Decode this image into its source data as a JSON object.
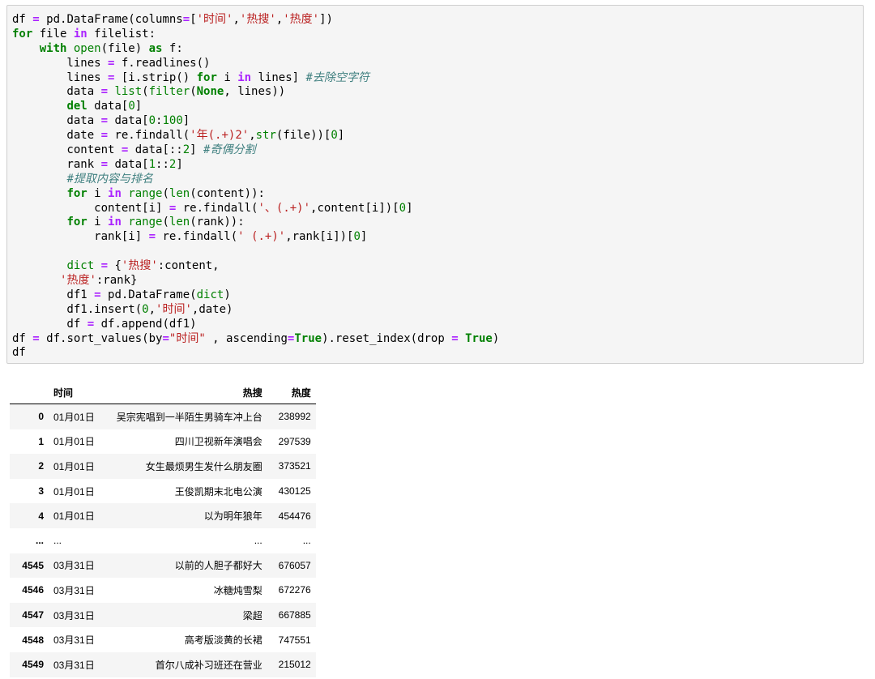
{
  "code_lines": [
    [
      [
        "df ",
        ""
      ],
      [
        "=",
        "op"
      ],
      [
        " pd.DataFrame(columns",
        ""
      ],
      [
        "=",
        "op"
      ],
      [
        "[",
        ""
      ],
      [
        "'时间'",
        "str"
      ],
      [
        ",",
        ""
      ],
      [
        "'热搜'",
        "str"
      ],
      [
        ",",
        ""
      ],
      [
        "'热度'",
        "str"
      ],
      [
        "])",
        ""
      ]
    ],
    [
      [
        "for",
        "kw"
      ],
      [
        " file ",
        ""
      ],
      [
        "in",
        "op"
      ],
      [
        " filelist:",
        ""
      ]
    ],
    [
      [
        "    ",
        ""
      ],
      [
        "with",
        "kw"
      ],
      [
        " ",
        ""
      ],
      [
        "open",
        "bi"
      ],
      [
        "(file) ",
        ""
      ],
      [
        "as",
        "kw"
      ],
      [
        " f:",
        ""
      ]
    ],
    [
      [
        "        lines ",
        ""
      ],
      [
        "=",
        "op"
      ],
      [
        " f.readlines()",
        ""
      ]
    ],
    [
      [
        "        lines ",
        ""
      ],
      [
        "=",
        "op"
      ],
      [
        " [i.strip() ",
        ""
      ],
      [
        "for",
        "kw"
      ],
      [
        " i ",
        ""
      ],
      [
        "in",
        "op"
      ],
      [
        " lines] ",
        ""
      ],
      [
        "#去除空字符",
        "cm"
      ]
    ],
    [
      [
        "        data ",
        ""
      ],
      [
        "=",
        "op"
      ],
      [
        " ",
        ""
      ],
      [
        "list",
        "bi"
      ],
      [
        "(",
        ""
      ],
      [
        "filter",
        "bi"
      ],
      [
        "(",
        ""
      ],
      [
        "None",
        "kw"
      ],
      [
        ", lines))",
        ""
      ]
    ],
    [
      [
        "        ",
        ""
      ],
      [
        "del",
        "kw"
      ],
      [
        " data[",
        ""
      ],
      [
        "0",
        "num"
      ],
      [
        "]",
        ""
      ]
    ],
    [
      [
        "        data ",
        ""
      ],
      [
        "=",
        "op"
      ],
      [
        " data[",
        ""
      ],
      [
        "0",
        "num"
      ],
      [
        ":",
        ""
      ],
      [
        "100",
        "num"
      ],
      [
        "]",
        ""
      ]
    ],
    [
      [
        "        date ",
        ""
      ],
      [
        "=",
        "op"
      ],
      [
        " re.findall(",
        ""
      ],
      [
        "'年(.+)2'",
        "str"
      ],
      [
        ",",
        ""
      ],
      [
        "str",
        "bi"
      ],
      [
        "(file))[",
        ""
      ],
      [
        "0",
        "num"
      ],
      [
        "]",
        ""
      ]
    ],
    [
      [
        "        content ",
        ""
      ],
      [
        "=",
        "op"
      ],
      [
        " data[::",
        ""
      ],
      [
        "2",
        "num"
      ],
      [
        "] ",
        ""
      ],
      [
        "#奇偶分割",
        "cm"
      ]
    ],
    [
      [
        "        rank ",
        ""
      ],
      [
        "=",
        "op"
      ],
      [
        " data[",
        ""
      ],
      [
        "1",
        "num"
      ],
      [
        "::",
        ""
      ],
      [
        "2",
        "num"
      ],
      [
        "]",
        ""
      ]
    ],
    [
      [
        "        ",
        ""
      ],
      [
        "#提取内容与排名",
        "cm"
      ]
    ],
    [
      [
        "        ",
        ""
      ],
      [
        "for",
        "kw"
      ],
      [
        " i ",
        ""
      ],
      [
        "in",
        "op"
      ],
      [
        " ",
        ""
      ],
      [
        "range",
        "bi"
      ],
      [
        "(",
        ""
      ],
      [
        "len",
        "bi"
      ],
      [
        "(content)):",
        ""
      ]
    ],
    [
      [
        "            content[i] ",
        ""
      ],
      [
        "=",
        "op"
      ],
      [
        " re.findall(",
        ""
      ],
      [
        "'、(.+)'",
        "str"
      ],
      [
        ",content[i])[",
        ""
      ],
      [
        "0",
        "num"
      ],
      [
        "]",
        ""
      ]
    ],
    [
      [
        "        ",
        ""
      ],
      [
        "for",
        "kw"
      ],
      [
        " i ",
        ""
      ],
      [
        "in",
        "op"
      ],
      [
        " ",
        ""
      ],
      [
        "range",
        "bi"
      ],
      [
        "(",
        ""
      ],
      [
        "len",
        "bi"
      ],
      [
        "(rank)):",
        ""
      ]
    ],
    [
      [
        "            rank[i] ",
        ""
      ],
      [
        "=",
        "op"
      ],
      [
        " re.findall(",
        ""
      ],
      [
        "' (.+)'",
        "str"
      ],
      [
        ",rank[i])[",
        ""
      ],
      [
        "0",
        "num"
      ],
      [
        "]",
        ""
      ]
    ],
    [
      [
        "",
        ""
      ]
    ],
    [
      [
        "        ",
        ""
      ],
      [
        "dict",
        "bi"
      ],
      [
        " ",
        ""
      ],
      [
        "=",
        "op"
      ],
      [
        " {",
        ""
      ],
      [
        "'热搜'",
        "str"
      ],
      [
        ":content,",
        ""
      ]
    ],
    [
      [
        "       ",
        ""
      ],
      [
        "'热度'",
        "str"
      ],
      [
        ":rank}",
        ""
      ]
    ],
    [
      [
        "        df1 ",
        ""
      ],
      [
        "=",
        "op"
      ],
      [
        " pd.DataFrame(",
        ""
      ],
      [
        "dict",
        "bi"
      ],
      [
        ")",
        ""
      ]
    ],
    [
      [
        "        df1.insert(",
        ""
      ],
      [
        "0",
        "num"
      ],
      [
        ",",
        ""
      ],
      [
        "'时间'",
        "str"
      ],
      [
        ",date)",
        ""
      ]
    ],
    [
      [
        "        df ",
        ""
      ],
      [
        "=",
        "op"
      ],
      [
        " df.append(df1)",
        ""
      ]
    ],
    [
      [
        "df ",
        ""
      ],
      [
        "=",
        "op"
      ],
      [
        " df.sort_values(by",
        ""
      ],
      [
        "=",
        "op"
      ],
      [
        "\"时间\"",
        "str"
      ],
      [
        " , ascending",
        ""
      ],
      [
        "=",
        "op"
      ],
      [
        "True",
        "kw"
      ],
      [
        ").reset_index(drop ",
        ""
      ],
      [
        "=",
        "op"
      ],
      [
        " ",
        ""
      ],
      [
        "True",
        "kw"
      ],
      [
        ")",
        ""
      ]
    ],
    [
      [
        "df",
        ""
      ]
    ]
  ],
  "table": {
    "columns": [
      "",
      "时间",
      "热搜",
      "热度"
    ],
    "rows": [
      [
        "0",
        "01月01日",
        "吴宗宪唱到一半陌生男骑车冲上台",
        "238992"
      ],
      [
        "1",
        "01月01日",
        "四川卫视新年演唱会",
        "297539"
      ],
      [
        "2",
        "01月01日",
        "女生最烦男生发什么朋友圈",
        "373521"
      ],
      [
        "3",
        "01月01日",
        "王俊凯期末北电公演",
        "430125"
      ],
      [
        "4",
        "01月01日",
        "以为明年狼年",
        "454476"
      ],
      [
        "...",
        "...",
        "...",
        "..."
      ],
      [
        "4545",
        "03月31日",
        "以前的人胆子都好大",
        "676057"
      ],
      [
        "4546",
        "03月31日",
        "冰糖炖雪梨",
        "672276"
      ],
      [
        "4547",
        "03月31日",
        "梁超",
        "667885"
      ],
      [
        "4548",
        "03月31日",
        "高考版淡黄的长裙",
        "747551"
      ],
      [
        "4549",
        "03月31日",
        "首尔八成补习班还在营业",
        "215012"
      ]
    ]
  }
}
